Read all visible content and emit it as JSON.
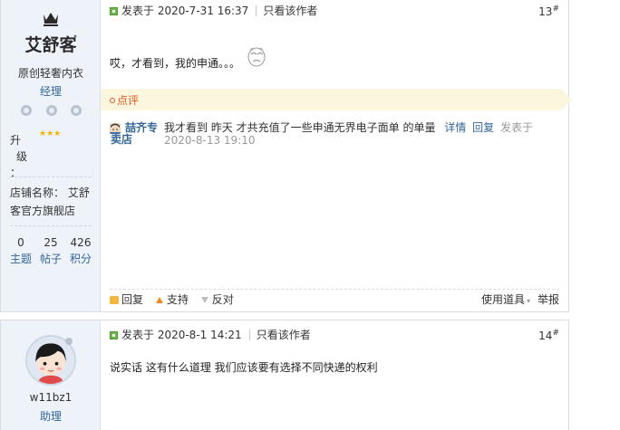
{
  "post1": {
    "author": {
      "name": "原创轻奢内衣",
      "group": "经理",
      "level_label": "升级：",
      "level_label_lines": [
        "升",
        "级",
        "："
      ],
      "stars": "★★★",
      "shop_label": "店铺名称：",
      "shop_name": "艾舒客官方旗舰店",
      "shop_line": "店铺名称： 艾舒客官方旗舰店",
      "logo_text": "艾舒客",
      "stats": [
        {
          "value": "0",
          "label": "主题"
        },
        {
          "value": "25",
          "label": "帖子"
        },
        {
          "value": "426",
          "label": "积分"
        }
      ]
    },
    "posted_at": "发表于 2020-7-31 16:37",
    "only_author": "只看该作者",
    "floor": "13",
    "floor_mark": "#",
    "content": "哎，才看到，我的申通。。。",
    "comment_title": "点评",
    "comment": {
      "author": "喆齐专卖店",
      "text": "我才看到 昨天 才共充值了一些申通无界电子面单 的单量",
      "detail": "详情",
      "reply": "回复",
      "posted_prefix": "发表于",
      "posted_at": "2020-8-13 19:10"
    },
    "actions": {
      "reply": "回复",
      "support": "支持",
      "oppose": "反对",
      "tools": "使用道具",
      "report": "举报"
    }
  },
  "post2": {
    "author": {
      "name": "w11bz1",
      "group": "助理"
    },
    "posted_at": "发表于 2020-8-1 14:21",
    "only_author": "只看该作者",
    "floor": "14",
    "floor_mark": "#",
    "content": "说实话 这有什么道理  我们应该要有选择不同快递的权利"
  },
  "colors": {
    "link": "#336699",
    "comment_bg": "#fdf6df",
    "comment_title": "#e35b1f",
    "sidebar_bg": "#eef3fa",
    "stars": "#f4b400"
  }
}
